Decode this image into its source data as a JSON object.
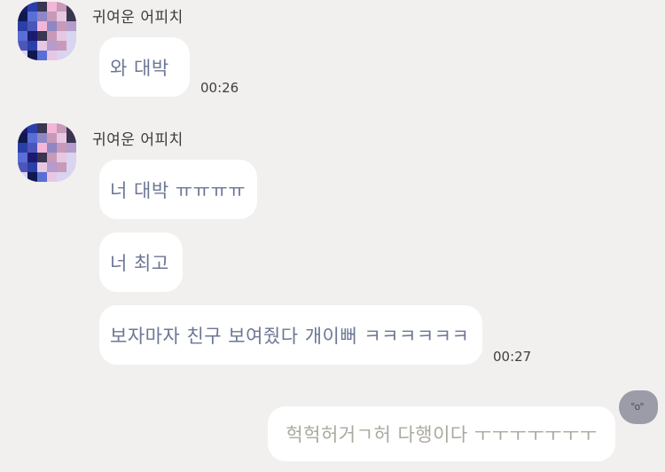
{
  "conversation": {
    "messages": [
      {
        "sender": "귀여운 어피치",
        "text": "와 대박",
        "time": "00:26"
      },
      {
        "sender": "귀여운 어피치",
        "text": "너 대박 ㅠㅠㅠㅠ"
      },
      {
        "text": "너 최고"
      },
      {
        "text": "보자마자 친구 보여줬다 개이뻐 ㅋㅋㅋㅋㅋㅋ",
        "time": "00:27"
      },
      {
        "mine": true,
        "text": "헉헉허거ㄱ허 다행이다 ㅜㅜㅜㅜㅜㅜㅜ"
      }
    ]
  },
  "avatar_palette": [
    "#1a1a6e",
    "#2b3fa8",
    "#5a6fd6",
    "#f3b6d9",
    "#c69ab8",
    "#d9d4f0",
    "#3a3550",
    "#8f86c4",
    "#e8c7e2",
    "#4c56b8",
    "#101850",
    "#b49ccd"
  ]
}
